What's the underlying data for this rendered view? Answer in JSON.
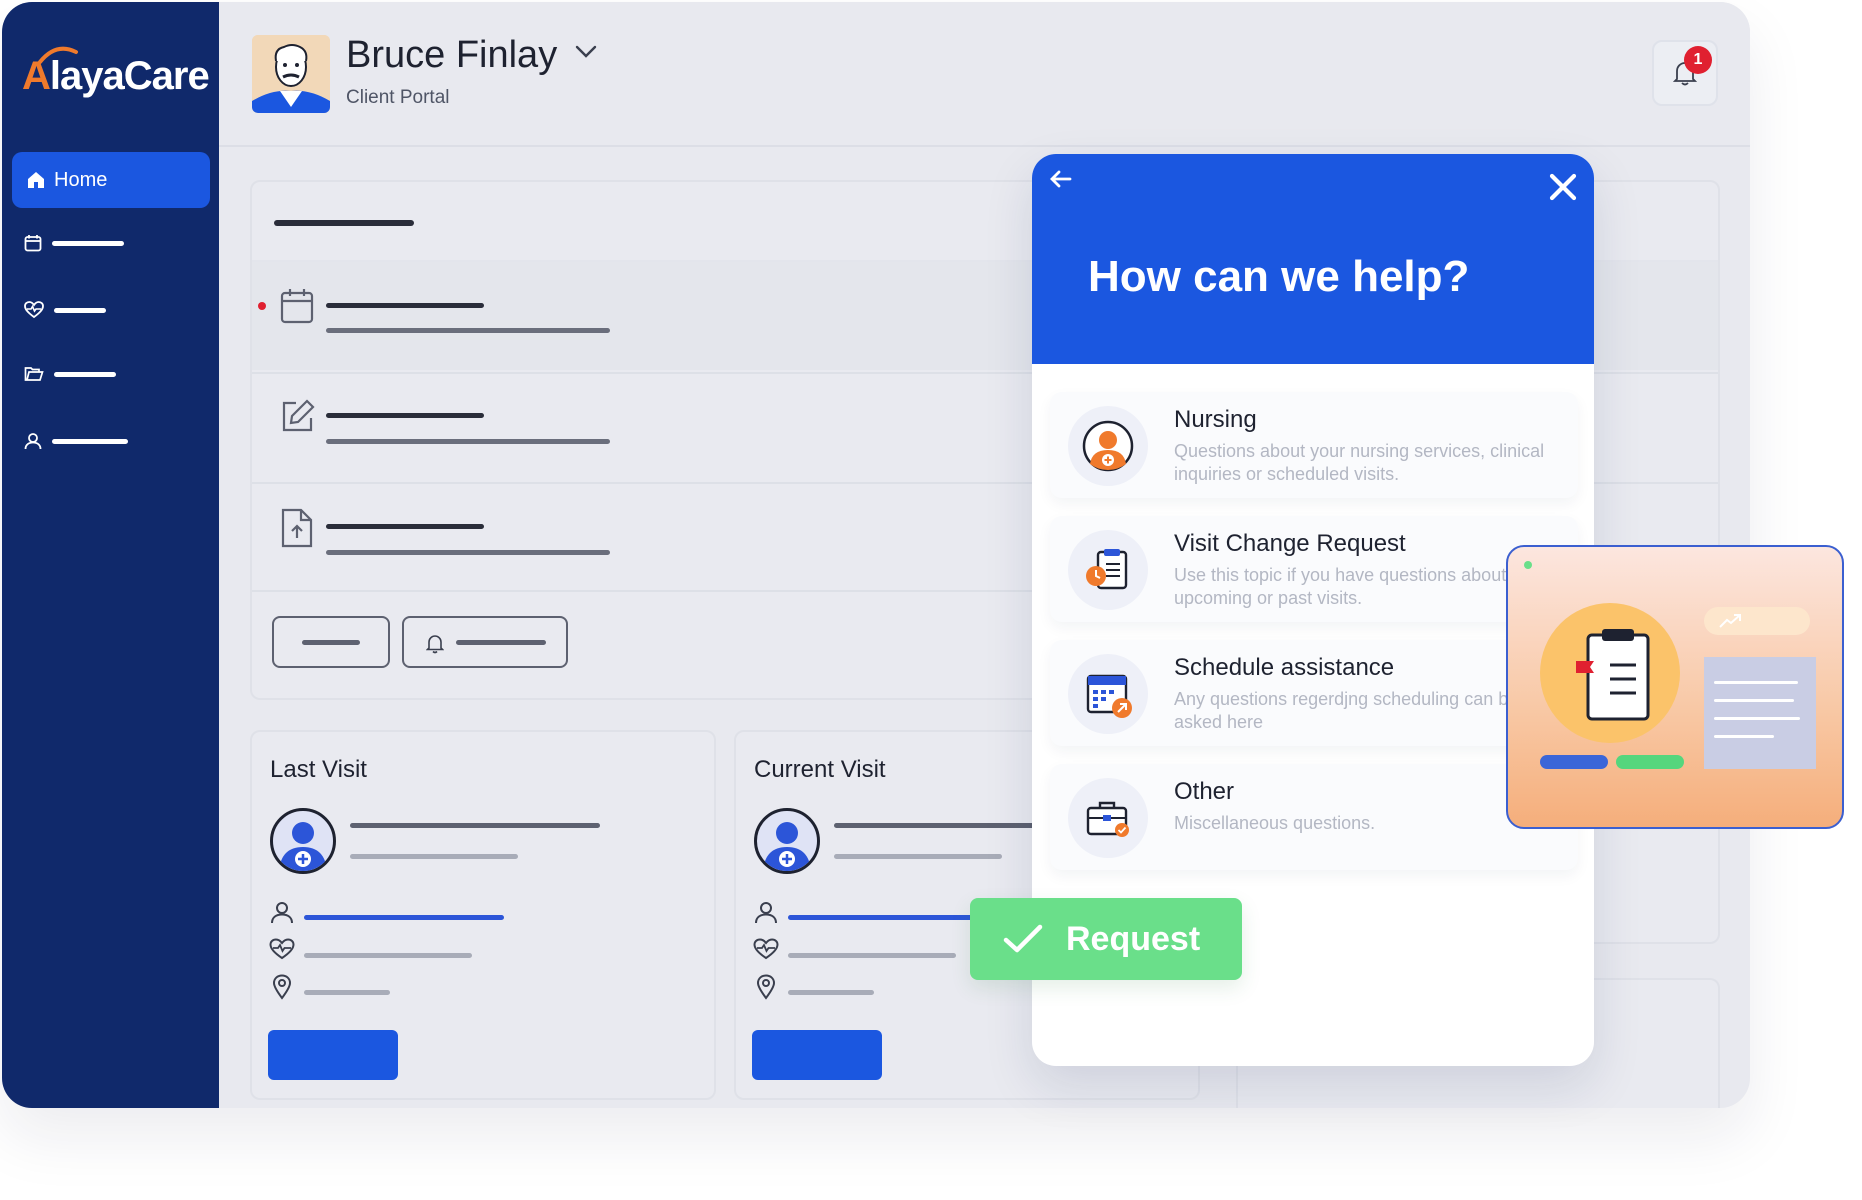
{
  "brand": {
    "name_a": "A",
    "name_b": "layaCare"
  },
  "sidebar": {
    "home_label": "Home",
    "items": [
      {
        "icon": "calendar-icon"
      },
      {
        "icon": "heartbeat-icon"
      },
      {
        "icon": "folder-icon"
      },
      {
        "icon": "user-icon"
      }
    ]
  },
  "header": {
    "user_name": "Bruce Finlay",
    "portal_label": "Client Portal",
    "notification_count": "1"
  },
  "visits": {
    "last_title": "Last Visit",
    "current_title": "Current Visit"
  },
  "help_modal": {
    "title": "How can we help?",
    "topics": [
      {
        "title": "Nursing",
        "desc": "Questions about your nursing services, clinical inquiries or scheduled visits.",
        "icon": "nurse-icon"
      },
      {
        "title": "Visit Change Request",
        "desc": "Use this topic if you have questions about upcoming or past visits.",
        "icon": "clipboard-clock-icon"
      },
      {
        "title": "Schedule assistance",
        "desc": "Any questions regerdjng scheduling can be asked here",
        "icon": "calendar-arrow-icon"
      },
      {
        "title": "Other",
        "desc": "Miscellaneous questions.",
        "icon": "briefcase-icon"
      }
    ]
  },
  "request_button": {
    "label": "Request"
  },
  "colors": {
    "sidebar": "#10296b",
    "primary": "#1b57e0",
    "success": "#6adf8a",
    "accent": "#f07a2c",
    "badge": "#e02030"
  }
}
